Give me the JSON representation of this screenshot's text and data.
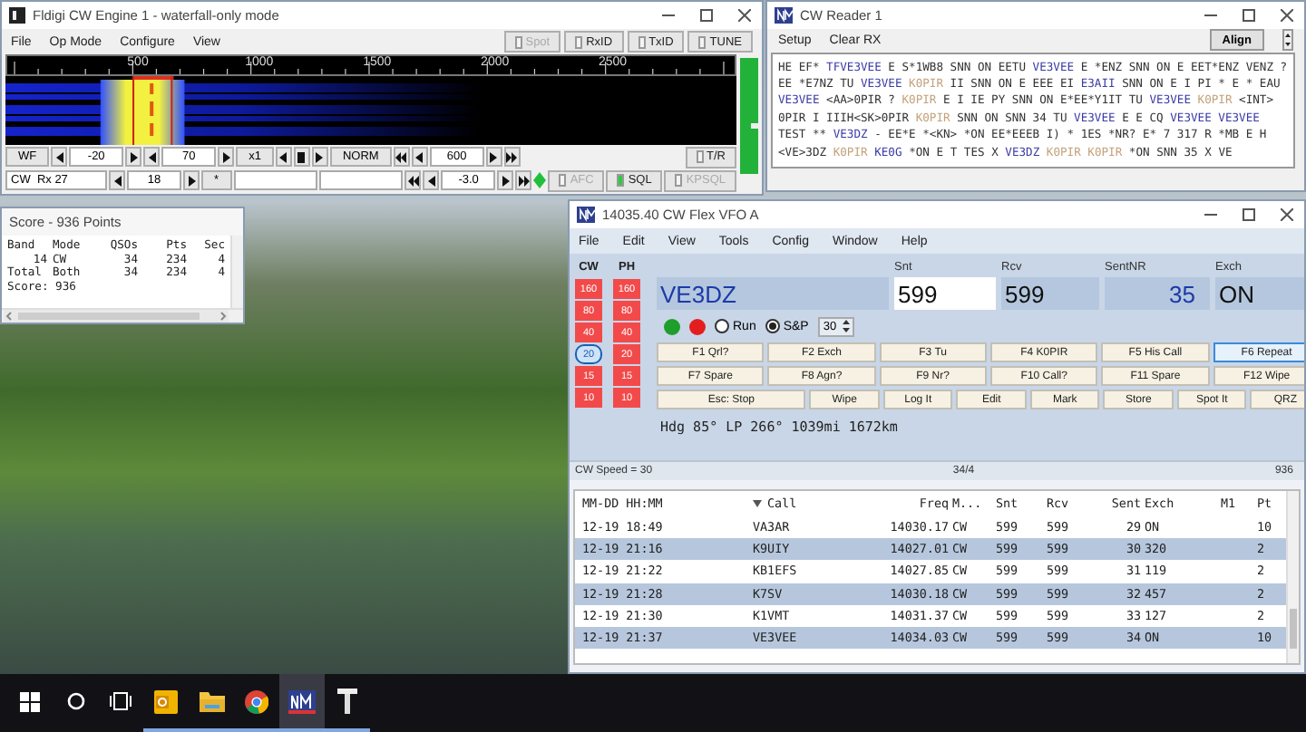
{
  "fldigi": {
    "title": "Fldigi CW Engine 1 - waterfall-only mode",
    "menu": [
      "File",
      "Op Mode",
      "Configure",
      "View"
    ],
    "toggles": [
      {
        "label": "Spot",
        "on": false,
        "disabled": true
      },
      {
        "label": "RxID",
        "on": false,
        "disabled": false
      },
      {
        "label": "TxID",
        "on": false,
        "disabled": false
      },
      {
        "label": "TUNE",
        "on": false,
        "disabled": false
      }
    ],
    "scale_labels": [
      "500",
      "1000",
      "1500",
      "2000",
      "2500"
    ],
    "rows": [
      [
        {
          "kind": "button",
          "label": "WF"
        },
        {
          "kind": "left"
        },
        {
          "kind": "field",
          "value": "-20"
        },
        {
          "kind": "right"
        },
        {
          "kind": "left"
        },
        {
          "kind": "field",
          "value": "70"
        },
        {
          "kind": "right"
        },
        {
          "kind": "button",
          "label": "x1"
        },
        {
          "kind": "left"
        },
        {
          "kind": "stop"
        },
        {
          "kind": "right"
        },
        {
          "kind": "button",
          "label": "NORM"
        },
        {
          "kind": "rewind"
        },
        {
          "kind": "left"
        },
        {
          "kind": "field",
          "value": "600"
        },
        {
          "kind": "right"
        },
        {
          "kind": "forward"
        },
        {
          "kind": "spacer"
        },
        {
          "kind": "toggle",
          "label": "T/R",
          "on": false,
          "disabled": false
        }
      ],
      [
        {
          "kind": "label",
          "label": "CW  Rx 27"
        },
        {
          "kind": "left"
        },
        {
          "kind": "field",
          "value": "18"
        },
        {
          "kind": "right"
        },
        {
          "kind": "button",
          "label": "*"
        },
        {
          "kind": "blank"
        },
        {
          "kind": "blank"
        },
        {
          "kind": "rewind"
        },
        {
          "kind": "left"
        },
        {
          "kind": "field",
          "value": "-3.0"
        },
        {
          "kind": "right"
        },
        {
          "kind": "forward"
        },
        {
          "kind": "diamond"
        },
        {
          "kind": "toggle",
          "label": "AFC",
          "on": false,
          "disabled": true
        },
        {
          "kind": "toggle",
          "label": "SQL",
          "on": true,
          "disabled": false
        },
        {
          "kind": "toggle",
          "label": "KPSQL",
          "on": false,
          "disabled": true
        }
      ]
    ]
  },
  "reader": {
    "title": "CW Reader 1",
    "menu": [
      "Setup",
      "Clear RX"
    ],
    "button": "Align",
    "lines": [
      [
        {
          "kind": "plain",
          "text": "HE EF* "
        },
        {
          "kind": "call",
          "text": "TFVE3VEE"
        },
        {
          "kind": "plain",
          "text": " E S*1WB8 SNN ON EETU "
        },
        {
          "kind": "call",
          "text": "VE3VEE"
        },
        {
          "kind": "plain",
          "text": " E *ENZ SNN ON E EET*ENZ VENZ ?"
        }
      ],
      [
        {
          "kind": "plain",
          "text": "EE *E7NZ TU "
        },
        {
          "kind": "call",
          "text": "VE3VEE"
        },
        {
          "kind": "own",
          "text": " K0PIR"
        },
        {
          "kind": "plain",
          "text": " II SNN ON E EEE EI "
        },
        {
          "kind": "call",
          "text": "E3AII"
        },
        {
          "kind": "plain",
          "text": " SNN ON E I PI * E * EAU"
        }
      ],
      [
        {
          "kind": "call",
          "text": "VE3VEE"
        },
        {
          "kind": "plain",
          "text": " <AA>0PIR ? "
        },
        {
          "kind": "own",
          "text": "K0PIR"
        },
        {
          "kind": "plain",
          "text": " E I IE PY SNN ON E*EE*Y1IT TU "
        },
        {
          "kind": "call",
          "text": "VE3VEE"
        },
        {
          "kind": "own",
          "text": " K0PIR"
        },
        {
          "kind": "plain",
          "text": " <INT>"
        }
      ],
      [
        {
          "kind": "plain",
          "text": "0PIR I IIIH<SK>0PIR "
        },
        {
          "kind": "own",
          "text": "K0PIR"
        },
        {
          "kind": "plain",
          "text": " SNN ON SNN 34 TU "
        },
        {
          "kind": "call",
          "text": "VE3VEE"
        },
        {
          "kind": "plain",
          "text": " E E CQ "
        },
        {
          "kind": "call",
          "text": "VE3VEE"
        },
        {
          "kind": "call",
          "text": " VE3VEE"
        }
      ],
      [
        {
          "kind": "plain",
          "text": "TEST ** "
        },
        {
          "kind": "call",
          "text": "VE3DZ"
        },
        {
          "kind": "plain",
          "text": " - EE*E *<KN> *ON EE*EEEB I) * 1ES *NR? E* 7 317 R *MB E H"
        }
      ],
      [
        {
          "kind": "plain",
          "text": "<VE>3DZ "
        },
        {
          "kind": "own",
          "text": "K0PIR"
        },
        {
          "kind": "call",
          "text": " KE0G"
        },
        {
          "kind": "plain",
          "text": " *ON E T TES X "
        },
        {
          "kind": "call",
          "text": "VE3DZ"
        },
        {
          "kind": "own",
          "text": " K0PIR"
        },
        {
          "kind": "own",
          "text": " K0PIR"
        },
        {
          "kind": "plain",
          "text": " *ON SNN 35 X VE"
        }
      ]
    ]
  },
  "score": {
    "title": "Score - 936 Points",
    "columns": [
      "Band",
      "Mode",
      "QSOs",
      "Pts",
      "Sec"
    ],
    "rows": [
      [
        "14",
        "CW",
        "34",
        "234",
        "4"
      ],
      [
        "Total",
        "Both",
        "34",
        "234",
        "4"
      ]
    ],
    "total": "Score: 936"
  },
  "flex": {
    "title": "14035.40 CW Flex VFO A",
    "menu": [
      "File",
      "Edit",
      "View",
      "Tools",
      "Config",
      "Window",
      "Help"
    ],
    "band_columns": [
      {
        "header": "CW",
        "bands": [
          {
            "label": "160",
            "selected": false
          },
          {
            "label": "80",
            "selected": false
          },
          {
            "label": "40",
            "selected": false
          },
          {
            "label": "20",
            "selected": true
          },
          {
            "label": "15",
            "selected": false
          },
          {
            "label": "10",
            "selected": false
          }
        ]
      },
      {
        "header": "PH",
        "bands": [
          {
            "label": "160",
            "selected": false
          },
          {
            "label": "80",
            "selected": false
          },
          {
            "label": "40",
            "selected": false
          },
          {
            "label": "20",
            "selected": false
          },
          {
            "label": "15",
            "selected": false
          },
          {
            "label": "10",
            "selected": false
          }
        ]
      }
    ],
    "fields": [
      {
        "kind": "call",
        "value": "VE3DZ",
        "focused": false
      },
      {
        "kind": "text",
        "label": "Snt",
        "value": "599",
        "focused": true
      },
      {
        "kind": "text",
        "label": "Rcv",
        "value": "599",
        "focused": false
      },
      {
        "kind": "number",
        "label": "SentNR",
        "value": "35",
        "focused": false
      },
      {
        "kind": "text",
        "label": "Exch",
        "value": "ON",
        "focused": false
      }
    ],
    "leds": [
      {
        "color": "#1e9e2a"
      },
      {
        "color": "#e41e1e"
      }
    ],
    "radios": [
      {
        "label": "Run",
        "selected": false
      },
      {
        "label": "S&P",
        "selected": true
      }
    ],
    "speed": "30",
    "keys": [
      [
        {
          "label": "F1 Qrl?",
          "focused": false
        },
        {
          "label": "F2 Exch",
          "focused": false
        },
        {
          "label": "F3 Tu",
          "focused": false
        },
        {
          "label": "F4 K0PIR",
          "focused": false
        },
        {
          "label": "F5 His Call",
          "focused": false
        },
        {
          "label": "F6 Repeat",
          "focused": true
        }
      ],
      [
        {
          "label": "F7 Spare",
          "focused": false
        },
        {
          "label": "F8 Agn?",
          "focused": false
        },
        {
          "label": "F9 Nr?",
          "focused": false
        },
        {
          "label": "F10 Call?",
          "focused": false
        },
        {
          "label": "F11 Spare",
          "focused": false
        },
        {
          "label": "F12 Wipe",
          "focused": false
        }
      ],
      [
        {
          "label": "Esc: Stop",
          "focused": false
        },
        {
          "label": "Wipe",
          "focused": false
        },
        {
          "label": "Log It",
          "focused": false
        },
        {
          "label": "Edit",
          "focused": false
        },
        {
          "label": "Mark",
          "focused": false
        },
        {
          "label": "Store",
          "focused": false
        },
        {
          "label": "Spot It",
          "focused": false
        },
        {
          "label": "QRZ",
          "focused": false
        }
      ]
    ],
    "heading": "Hdg 85° LP 266° 1039mi 1672km",
    "status": [
      "CW Speed = 30",
      "34/4",
      "936"
    ],
    "log": {
      "columns": [
        "MM-DD HH:MM",
        "Call",
        "Freq",
        "M...",
        "Snt",
        "Rcv",
        "Sent",
        "Exch",
        "M1",
        "Pt"
      ],
      "rows": [
        [
          "12-19 18:49",
          "VA3AR",
          "14030.17",
          "CW",
          "599",
          "599",
          "29",
          "ON",
          "",
          "10"
        ],
        [
          "12-19 21:16",
          "K9UIY",
          "14027.01",
          "CW",
          "599",
          "599",
          "30",
          "320",
          "",
          "2"
        ],
        [
          "12-19 21:22",
          "KB1EFS",
          "14027.85",
          "CW",
          "599",
          "599",
          "31",
          "119",
          "",
          "2"
        ],
        [
          "12-19 21:28",
          "K7SV",
          "14030.18",
          "CW",
          "599",
          "599",
          "32",
          "457",
          "",
          "2"
        ],
        [
          "12-19 21:30",
          "K1VMT",
          "14031.37",
          "CW",
          "599",
          "599",
          "33",
          "127",
          "",
          "2"
        ],
        [
          "12-19 21:37",
          "VE3VEE",
          "14034.03",
          "CW",
          "599",
          "599",
          "34",
          "ON",
          "",
          "10"
        ]
      ]
    }
  },
  "taskbar": {
    "apps": [
      {
        "kind": "mail",
        "running": true,
        "active": false
      },
      {
        "kind": "folder",
        "running": true,
        "active": false
      },
      {
        "kind": "browser",
        "running": true,
        "active": false
      },
      {
        "kind": "logger",
        "running": true,
        "active": true
      },
      {
        "kind": "tool",
        "running": true,
        "active": false
      }
    ]
  }
}
